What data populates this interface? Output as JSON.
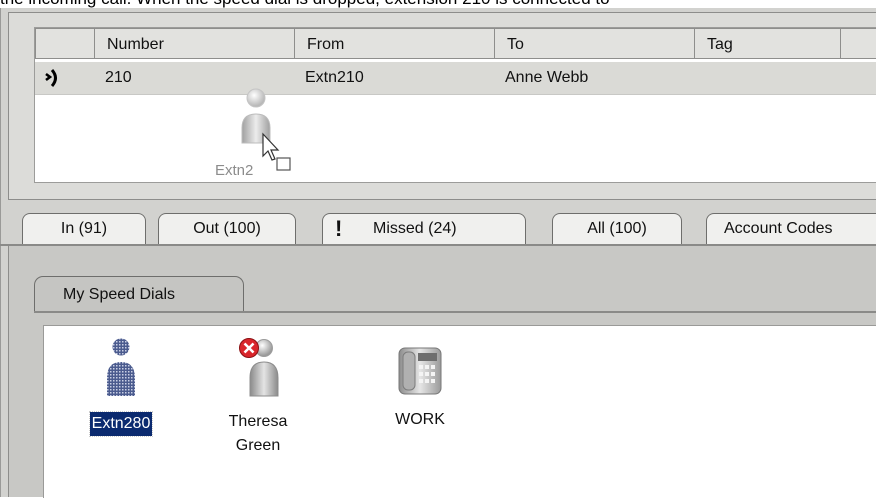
{
  "caption": "the incoming call. When the speed dial is dropped, extension 210 is connected to",
  "call_table": {
    "columns": [
      "Number",
      "From",
      "To",
      "Tag"
    ],
    "row": {
      "number": "210",
      "from": "Extn210",
      "to": "Anne Webb",
      "tag": ""
    },
    "drag_label": "Extn2"
  },
  "tabs": [
    {
      "label": "In (91)"
    },
    {
      "label": "Out (100)"
    },
    {
      "label": "Missed (24)"
    },
    {
      "label": "All (100)"
    },
    {
      "label": "Account Codes"
    }
  ],
  "speed_dial_tab": "My Speed Dials",
  "speed_dials": [
    {
      "label": "Extn280",
      "icon": "user-icon",
      "selected": true
    },
    {
      "label": "Theresa Green",
      "line1": "Theresa",
      "line2": "Green",
      "icon": "user-busy-icon"
    },
    {
      "label": "WORK",
      "icon": "desk-phone-icon"
    }
  ],
  "colors": {
    "selection": "#0b2a6f",
    "busy": "#d9262b",
    "row": "#dadad6"
  }
}
